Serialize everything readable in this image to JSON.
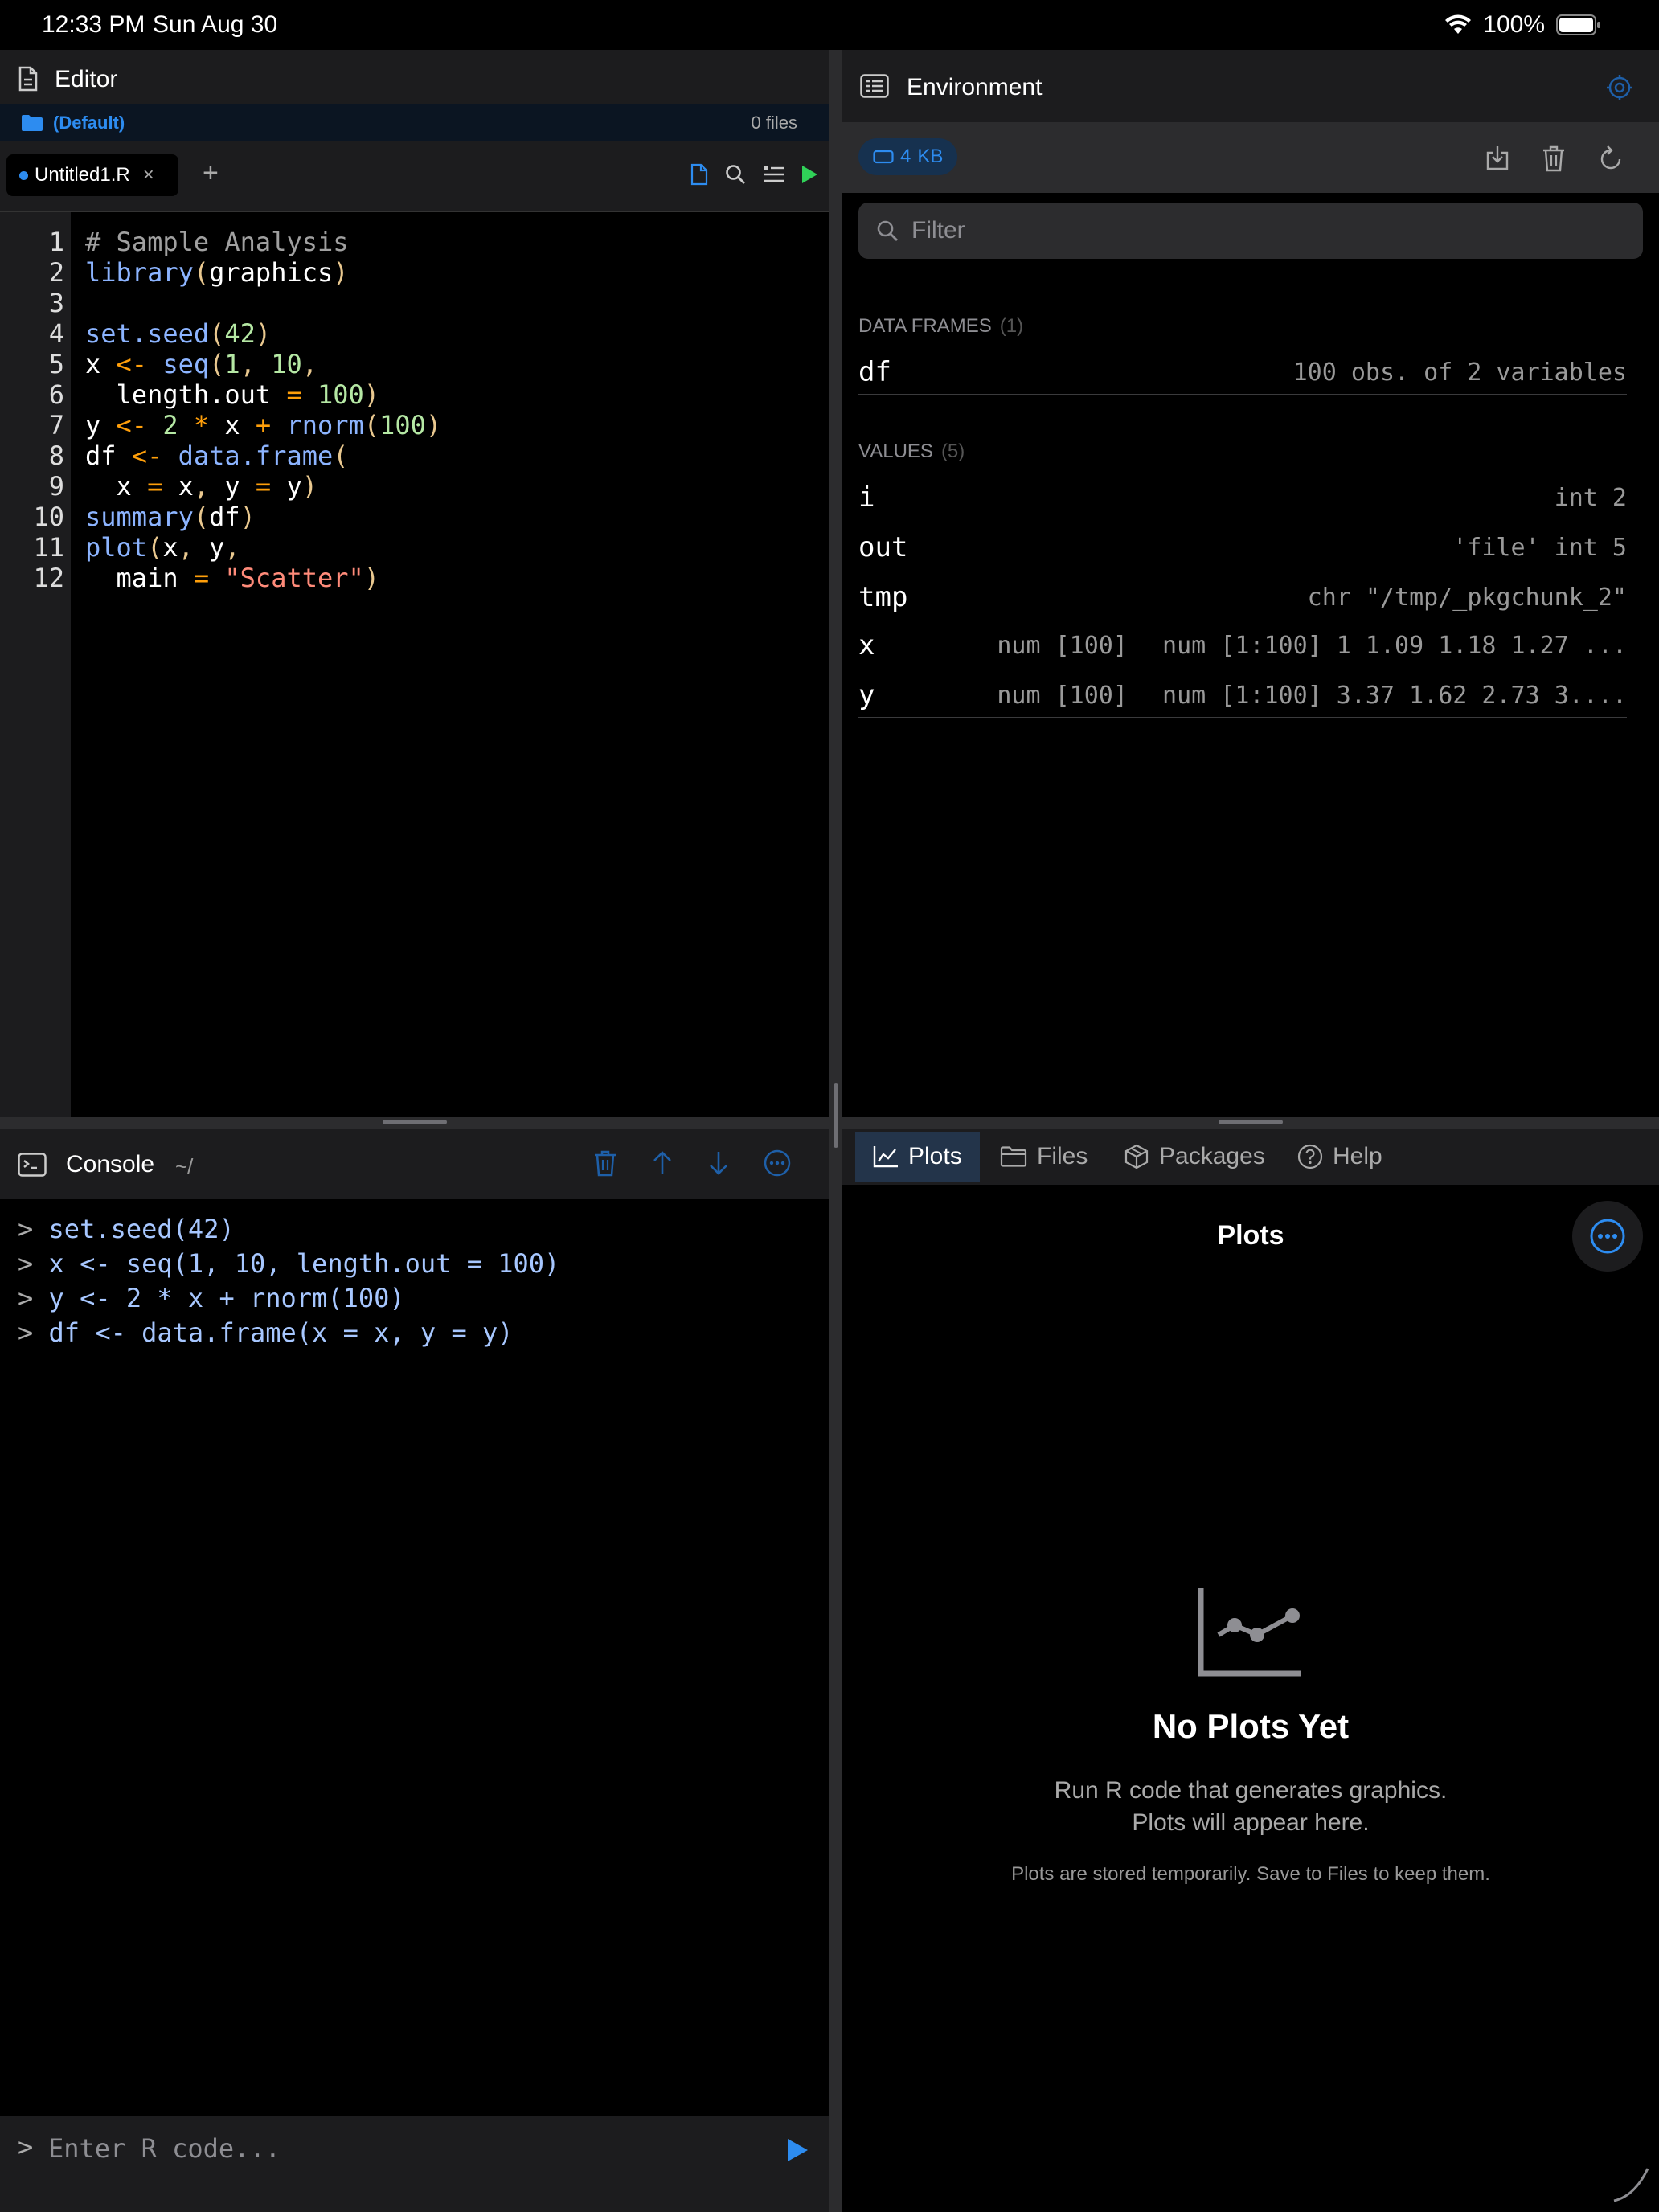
{
  "status_bar": {
    "time": "12:33 PM",
    "date": "Sun Aug 30",
    "battery": "100%"
  },
  "editor": {
    "title": "Editor",
    "project": "(Default)",
    "file_count": "0 files",
    "tab_name": "Untitled1.R",
    "tab_close": "×",
    "add_tab": "+",
    "line_numbers": "1\n2\n3\n4\n5\n6\n7\n8\n9\n10\n11\n12"
  },
  "console": {
    "title": "Console",
    "path": "~/",
    "prompt": ">",
    "placeholder": "Enter R code..."
  },
  "environment": {
    "title": "Environment",
    "memory_value": "4",
    "memory_unit": "KB",
    "filter_placeholder": "Filter",
    "data_frames_label": "DATA FRAMES",
    "data_frames_count": "(1)",
    "data_frames": [
      {
        "name": "df",
        "type": "",
        "value": "100 obs. of 2 variables"
      }
    ],
    "values_label": "VALUES",
    "values_count": "(5)",
    "values": [
      {
        "name": "i",
        "type": "",
        "value": "int 2"
      },
      {
        "name": "out",
        "type": "",
        "value": "'file' int 5"
      },
      {
        "name": "tmp",
        "type": "",
        "value": "chr \"/tmp/_pkgchunk_2\""
      },
      {
        "name": "x",
        "type": "num [100]",
        "value": "num [1:100] 1 1.09 1.18 1.27 ..."
      },
      {
        "name": "y",
        "type": "num [100]",
        "value": "num [1:100] 3.37 1.62 2.73 3...."
      }
    ]
  },
  "bottom_tabs": [
    {
      "label": "Plots"
    },
    {
      "label": "Files"
    },
    {
      "label": "Packages"
    },
    {
      "label": "Help"
    }
  ],
  "plots": {
    "title": "Plots",
    "empty_title": "No Plots Yet",
    "empty_line1": "Run R code that generates graphics.",
    "empty_line2": "Plots will appear here.",
    "empty_note": "Plots are stored temporarily. Save to Files to keep them."
  },
  "colors": {
    "accent": "#2d8cf0",
    "run_green": "#30d158",
    "panel": "#1c1c1e"
  }
}
